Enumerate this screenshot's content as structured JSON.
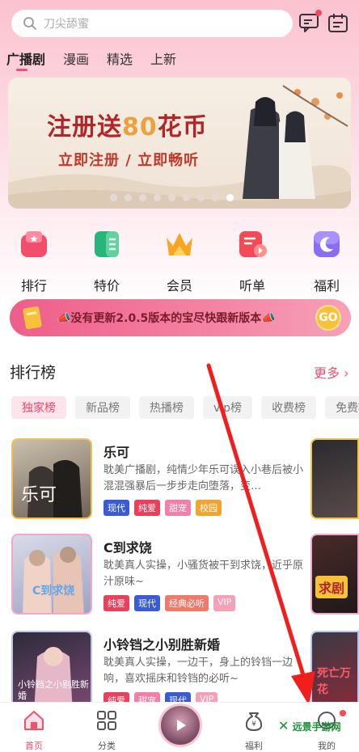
{
  "search": {
    "placeholder": "刀尖舔蜜"
  },
  "tabs": [
    {
      "label": "广播剧",
      "active": true
    },
    {
      "label": "漫画"
    },
    {
      "label": "精选"
    },
    {
      "label": "上新"
    }
  ],
  "banner": {
    "title_prefix": "注册送",
    "title_number": "80",
    "title_suffix": "花币",
    "subtitle": "立即注册 / 立即畅听",
    "dots": 9,
    "active_dot": 8
  },
  "categories": [
    {
      "label": "排行",
      "icon": "ranking-icon"
    },
    {
      "label": "特价",
      "icon": "book-icon"
    },
    {
      "label": "会员",
      "icon": "crown-icon"
    },
    {
      "label": "听单",
      "icon": "playlist-icon"
    },
    {
      "label": "福利",
      "icon": "gift-moon-icon"
    }
  ],
  "notice": {
    "text": "📣没有更新2.0.5版本的宝尽快跟新版本📣",
    "badge": "GO"
  },
  "ranking": {
    "title": "排行榜",
    "more": "更多",
    "chips": [
      {
        "label": "独家榜",
        "active": true
      },
      {
        "label": "新品榜"
      },
      {
        "label": "热播榜"
      },
      {
        "label": "vip榜"
      },
      {
        "label": "收费榜"
      },
      {
        "label": "免费榜"
      }
    ],
    "items": [
      {
        "title": "乐可",
        "desc": "耽美广播剧，纯情少年乐可误入小巷后被小混混强暴后一步步走向堕落，变…",
        "tags": [
          "现代",
          "纯爱",
          "甜宠",
          "校园"
        ],
        "cover_text": "乐可"
      },
      {
        "title": "C到求饶",
        "desc": "耽美真人实操，小骚货被干到求饶，近乎原汁原味~",
        "tags": [
          "纯爱",
          "现代",
          "经典必听",
          "VIP"
        ],
        "cover_text": "C到求饶"
      },
      {
        "title": "小铃铛之小别胜新婚",
        "desc": "耽美真人实操，一边干，身上的铃铛一边响，喜欢摇床和铃铛的必听~",
        "tags": [
          "纯爱",
          "甜宠",
          "现代",
          "VIP"
        ],
        "cover_text": "小铃铛之小别胜新婚"
      }
    ],
    "side_covers": [
      "",
      "求剧",
      "死亡万花"
    ]
  },
  "nav": [
    {
      "label": "首页",
      "icon": "home-icon",
      "active": true
    },
    {
      "label": "分类",
      "icon": "grid-icon"
    },
    {
      "label": "福利",
      "icon": "money-bag-icon"
    },
    {
      "label": "我的",
      "icon": "profile-icon"
    }
  ],
  "watermark": "远景手游网",
  "colors": {
    "accent": "#f0516e",
    "tag_modern": "#3b5bd6",
    "tag_pure": "#e9405d",
    "tag_sweet": "#f17fa8",
    "tag_campus": "#f0a531",
    "tag_classic": "#ee7a6b",
    "tag_vip": "#f3a0b8"
  }
}
